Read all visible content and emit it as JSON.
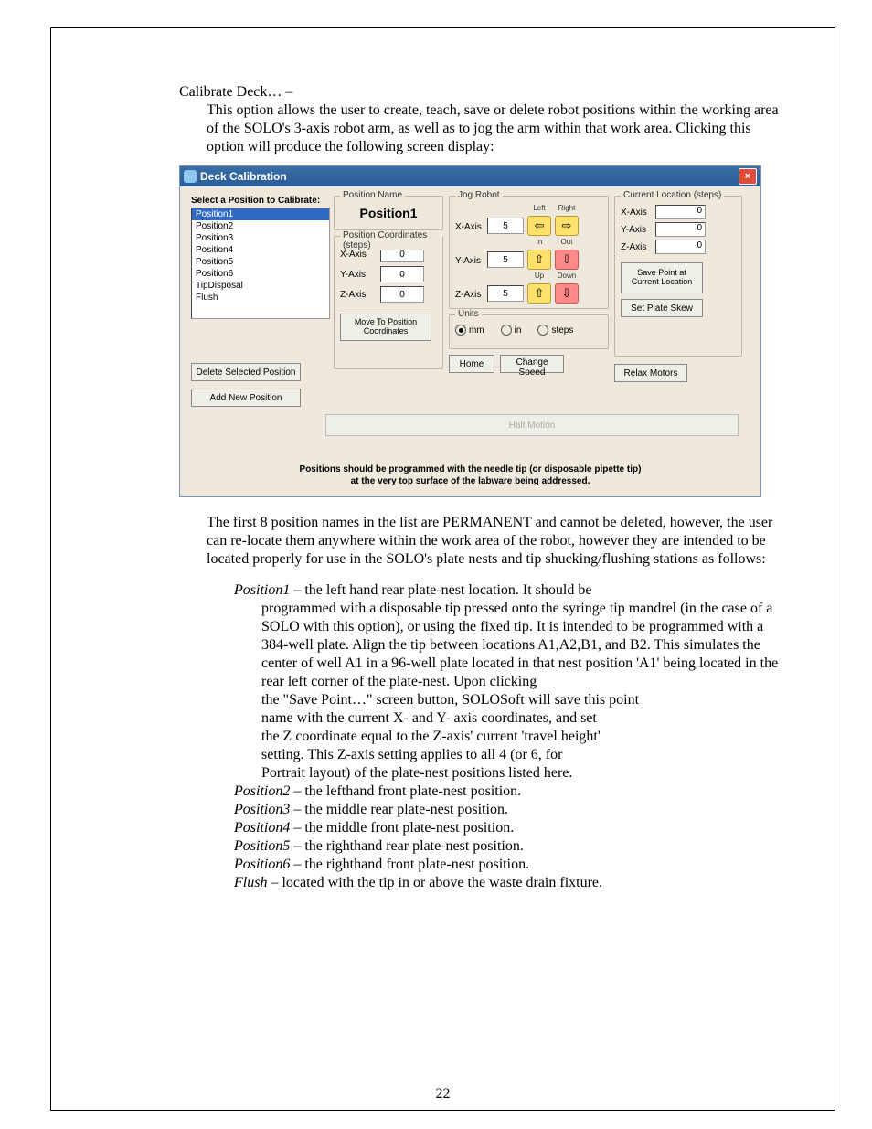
{
  "page_number": "22",
  "intro": {
    "heading": "Calibrate Deck… –",
    "p1": "This option allows the user to create, teach, save or delete robot positions within the working area of the SOLO's 3-axis robot arm, as well as to jog the arm within that work area.  Clicking this option will produce the following screen display:"
  },
  "win": {
    "title": "Deck Calibration",
    "select_label": "Select a Position to Calibrate:",
    "positions": [
      "Position1",
      "Position2",
      "Position3",
      "Position4",
      "Position5",
      "Position6",
      "TipDisposal",
      "Flush"
    ],
    "delete_btn": "Delete Selected Position",
    "add_btn": "Add New Position",
    "posname_group": "Position Name",
    "posname_value": "Position1",
    "poscoord_group": "Position Coordinates (steps)",
    "x_label": "X-Axis",
    "y_label": "Y-Axis",
    "z_label": "Z-Axis",
    "coord_x": "0",
    "coord_y": "0",
    "coord_z": "0",
    "move_btn": "Move To Position Coordinates",
    "jog_group": "Jog Robot",
    "jog_labels": {
      "left": "Left",
      "right": "Right",
      "in": "In",
      "out": "Out",
      "up": "Up",
      "down": "Down"
    },
    "jog_x": "5",
    "jog_y": "5",
    "jog_z": "5",
    "units_group": "Units",
    "units": {
      "mm": "mm",
      "in": "in",
      "steps": "steps"
    },
    "home_btn": "Home",
    "change_speed_btn": "Change Speed",
    "relax_btn": "Relax Motors",
    "halt_btn": "Halt Motion",
    "curloc_group": "Current Location (steps)",
    "cur_x": "0",
    "cur_y": "0",
    "cur_z": "0",
    "save_btn": "Save Point at Current Location",
    "skew_btn": "Set Plate Skew",
    "disclaimer1": "Positions should be programmed with the needle tip (or disposable pipette tip)",
    "disclaimer2": "at the very top surface of the labware being addressed."
  },
  "after1": "The first 8 position names in the list are PERMANENT and cannot be deleted, however, the user can re-locate them anywhere within the work area of the robot, however they are intended to be located properly for use in the SOLO's plate nests and tip shucking/flushing stations as follows:",
  "items": {
    "p1_label": "Position1",
    "p1_a": " – the left hand rear plate-nest location.  It should be",
    "p1_b1": "programmed with a disposable tip pressed onto the syringe tip mandrel (in the case of a SOLO with this option), or using the fixed tip.  It is intended to be programmed with a 384-well plate. Align the tip between locations A1,A2,B1, and B2. This simulates the center of well A1 in a 96-well plate located in that nest position 'A1' being located in the rear left corner of the plate-nest. Upon clicking",
    "p1_b2": "the \"Save Point…\" screen button, SOLOSoft will save this point",
    "p1_b3": "name with the current X- and Y- axis coordinates, and set",
    "p1_b4": "the Z coordinate equal to the Z-axis' current 'travel height'",
    "p1_b5": "setting. This Z-axis setting applies to all 4 (or 6, for",
    "p1_b6": " Portrait layout) of the plate-nest positions listed here.",
    "p2_label": "Position2",
    "p2": " – the lefthand front plate-nest position.",
    "p3_label": "Position3",
    "p3": " – the middle rear plate-nest position.",
    "p4_label": "Position4",
    "p4": " – the middle front plate-nest position.",
    "p5_label": "Position5",
    "p5": " – the righthand rear plate-nest position.",
    "p6_label": "Position6",
    "p6": " – the righthand front plate-nest position.",
    "flush_label": "Flush",
    "flush": " – located with the tip in or above the waste drain fixture."
  }
}
